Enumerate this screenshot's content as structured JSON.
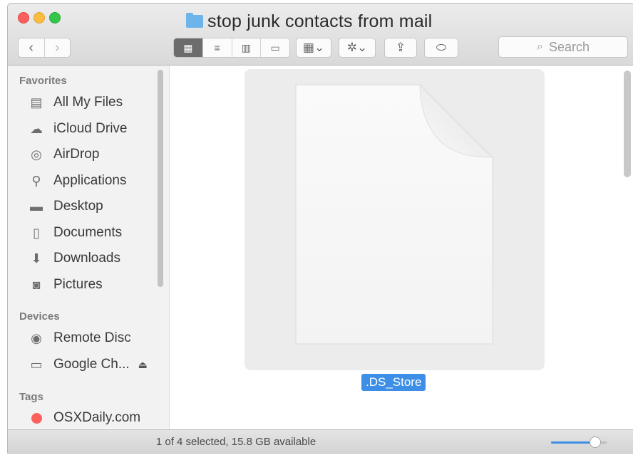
{
  "window": {
    "title": "stop junk contacts from mail"
  },
  "toolbar": {
    "back_glyph": "‹",
    "forward_glyph": "›",
    "view_modes": [
      {
        "name": "icon-view",
        "glyph": "▦",
        "active": true
      },
      {
        "name": "list-view",
        "glyph": "≡",
        "active": false
      },
      {
        "name": "column-view",
        "glyph": "▥",
        "active": false
      },
      {
        "name": "coverflow-view",
        "glyph": "▭",
        "active": false
      }
    ],
    "arrange_glyph": "▦⌄",
    "action_glyph": "✲⌄",
    "share_glyph": "⇪",
    "tag_glyph": "⬭",
    "search_placeholder": "Search",
    "search_icon": "⌕"
  },
  "sidebar": {
    "sections": {
      "favorites": "Favorites",
      "devices": "Devices",
      "tags": "Tags"
    },
    "favorites": [
      {
        "label": "All My Files",
        "icon": "all-my-files-icon",
        "glyph": "▤"
      },
      {
        "label": "iCloud Drive",
        "icon": "cloud-icon",
        "glyph": "☁"
      },
      {
        "label": "AirDrop",
        "icon": "airdrop-icon",
        "glyph": "◎"
      },
      {
        "label": "Applications",
        "icon": "applications-icon",
        "glyph": "⚲"
      },
      {
        "label": "Desktop",
        "icon": "desktop-icon",
        "glyph": "▬"
      },
      {
        "label": "Documents",
        "icon": "documents-icon",
        "glyph": "▯"
      },
      {
        "label": "Downloads",
        "icon": "downloads-icon",
        "glyph": "⬇"
      },
      {
        "label": "Pictures",
        "icon": "camera-icon",
        "glyph": "◙"
      }
    ],
    "devices": [
      {
        "label": "Remote Disc",
        "icon": "disc-icon",
        "glyph": "◉"
      },
      {
        "label": "Google Ch...",
        "icon": "drive-icon",
        "glyph": "▭",
        "eject": "⏏"
      }
    ],
    "tags": [
      {
        "label": "OSXDaily.com",
        "icon": "red-tag-icon",
        "color": "#fc605c"
      }
    ]
  },
  "content": {
    "selected_file": ".DS_Store"
  },
  "status": {
    "text": "1 of 4 selected, 15.8 GB available",
    "icon_size_level": 0.8
  },
  "colors": {
    "accent": "#3d8ee6",
    "folder": "#6db4ea",
    "tag_red": "#fc605c"
  }
}
